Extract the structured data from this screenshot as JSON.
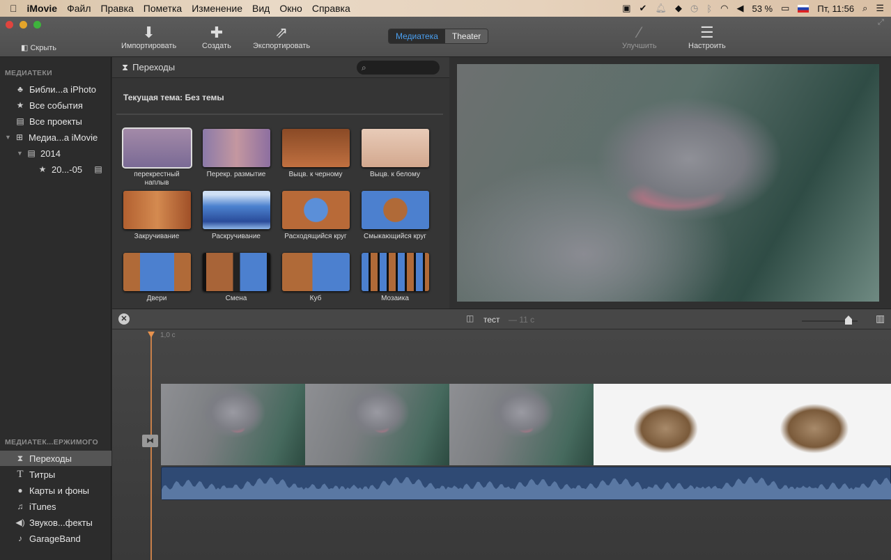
{
  "menubar": {
    "app": "iMovie",
    "items": [
      "Файл",
      "Правка",
      "Пометка",
      "Изменение",
      "Вид",
      "Окно",
      "Справка"
    ],
    "battery": "53 %",
    "clock": "Пт, 11:56"
  },
  "toolbar": {
    "hide": "Скрыть",
    "import": "Импортировать",
    "create": "Создать",
    "export": "Экспортировать",
    "seg_library": "Медиатека",
    "seg_theater": "Theater",
    "enhance": "Улучшить",
    "adjust": "Настроить"
  },
  "sidebar": {
    "libraries_header": "МЕДИАТЕКИ",
    "libraries": [
      {
        "label": "Библи...a iPhoto",
        "icon": "palm-icon"
      },
      {
        "label": "Все события",
        "icon": "star-icon"
      },
      {
        "label": "Все проекты",
        "icon": "clapper-icon"
      },
      {
        "label": "Медиа...а iMovie",
        "icon": "grid-icon"
      },
      {
        "label": "2014",
        "icon": "folder-icon"
      },
      {
        "label": "20...-05",
        "icon": "star-icon"
      }
    ],
    "content_header": "МЕДИАТЕК...ЕРЖИМОГО",
    "content": [
      {
        "label": "Переходы",
        "icon": "transition-icon"
      },
      {
        "label": "Титры",
        "icon": "title-icon"
      },
      {
        "label": "Карты и фоны",
        "icon": "globe-icon"
      },
      {
        "label": "iTunes",
        "icon": "music-note-icon"
      },
      {
        "label": "Звуков...фекты",
        "icon": "speaker-icon"
      },
      {
        "label": "GarageBand",
        "icon": "guitar-icon"
      }
    ]
  },
  "browser": {
    "title": "Переходы",
    "search_placeholder": "",
    "theme": "Текущая тема: Без темы",
    "transitions": [
      "перекрестный наплыв",
      "Перекр. размытие",
      "Выцв. к черному",
      "Выцв. к белому",
      "Закручивание",
      "Раскручивание",
      "Расходящийся круг",
      "Смыкающийся круг",
      "Двери",
      "Смена",
      "Куб",
      "Мозаика"
    ]
  },
  "timeline": {
    "project": "тест",
    "duration": "— 11 с",
    "playhead": "1,0 с"
  }
}
